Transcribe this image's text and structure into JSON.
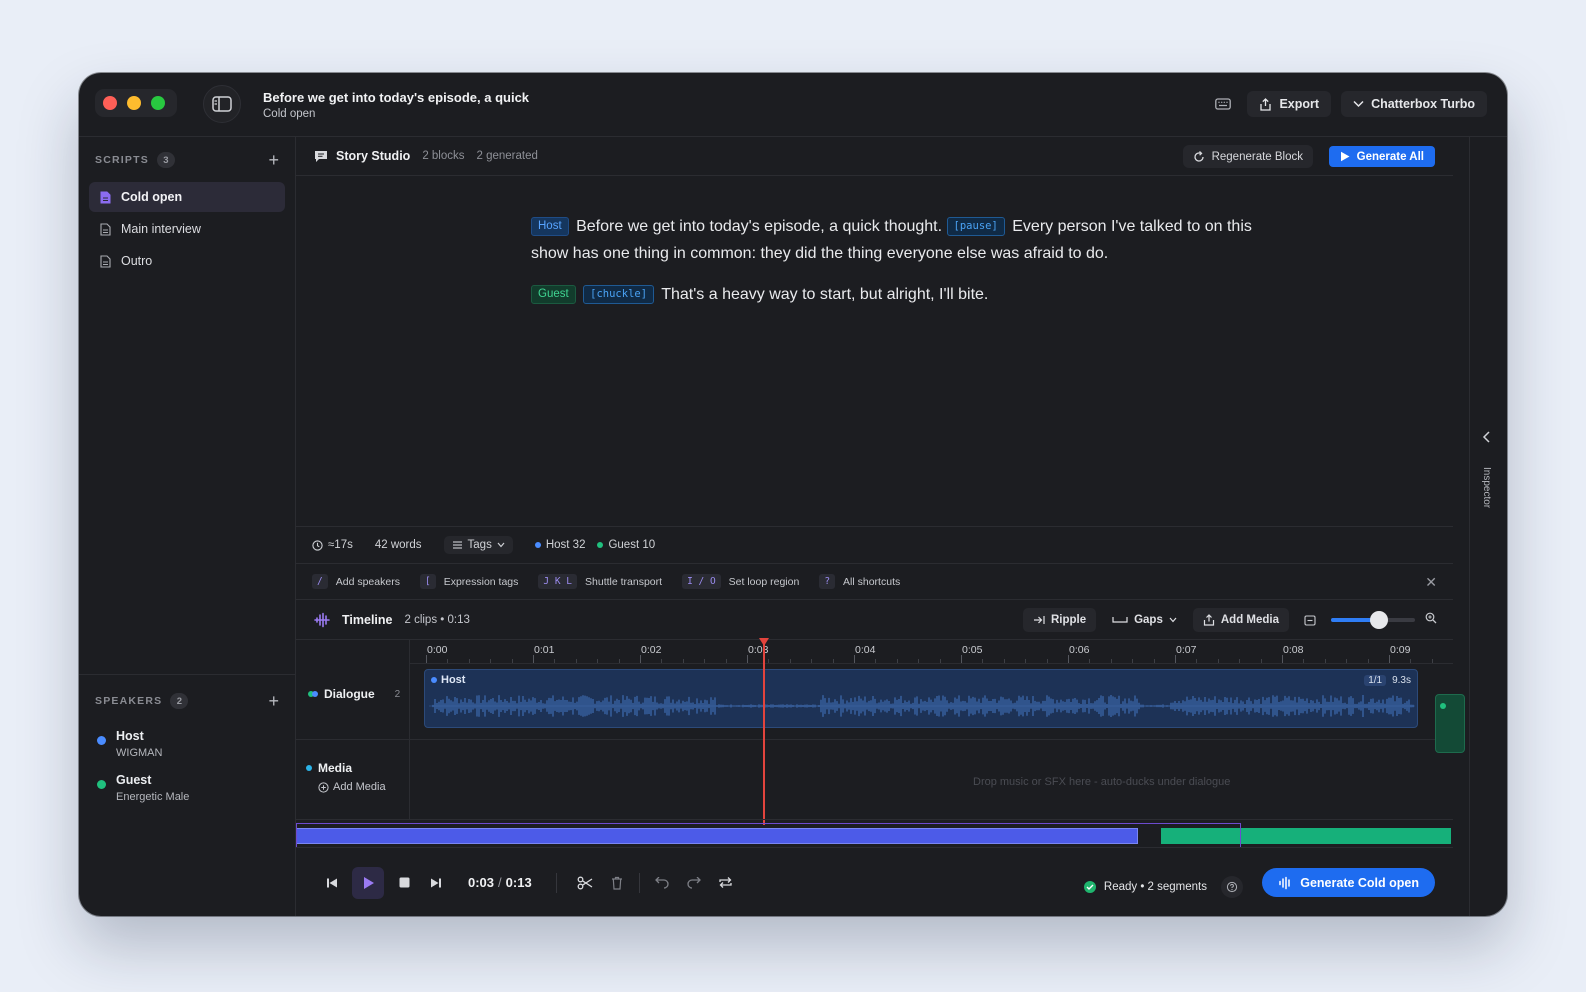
{
  "window": {
    "doc_title": "Before we get into today's episode, a quick",
    "doc_subtitle": "Cold open",
    "export_label": "Export",
    "model_label": "Chatterbox Turbo"
  },
  "sidebar": {
    "scripts_heading": "SCRIPTS",
    "scripts_count": "3",
    "scripts": [
      {
        "label": "Cold open",
        "active": true
      },
      {
        "label": "Main interview",
        "active": false
      },
      {
        "label": "Outro",
        "active": false
      }
    ],
    "speakers_heading": "SPEAKERS",
    "speakers_count": "2",
    "speakers": [
      {
        "name": "Host",
        "voice": "WIGMAN",
        "color": "#4a8cff"
      },
      {
        "name": "Guest",
        "voice": "Energetic Male",
        "color": "#20c07e"
      }
    ]
  },
  "studio": {
    "title": "Story Studio",
    "blocks": "2 blocks",
    "generated": "2 generated",
    "regen_label": "Regenerate Block",
    "generate_all_label": "Generate All"
  },
  "editor": {
    "p1": {
      "speaker_tag": "Host",
      "text_a": "Before we get into today's episode, a quick thought.",
      "expr_tag": "[pause]",
      "text_b": "Every person I've talked to on this show has one thing in common: they did the thing everyone else was afraid to do."
    },
    "p2": {
      "speaker_tag": "Guest",
      "expr_tag": "[chuckle]",
      "text_a": "That's a heavy way to start, but alright, I'll bite."
    }
  },
  "status": {
    "duration": "≈17s",
    "words": "42 words",
    "tags_label": "Tags",
    "host_count": "Host 32",
    "guest_count": "Guest 10"
  },
  "shortcuts": [
    {
      "key": "/",
      "label": "Add speakers"
    },
    {
      "key": "[",
      "label": "Expression tags"
    },
    {
      "key": "J K L",
      "label": "Shuttle transport"
    },
    {
      "key": "I / O",
      "label": "Set loop region"
    },
    {
      "key": "?",
      "label": "All shortcuts"
    }
  ],
  "timeline": {
    "title": "Timeline",
    "meta": "2 clips • 0:13",
    "ripple_label": "Ripple",
    "gaps_label": "Gaps",
    "add_media_label": "Add Media",
    "zoom_level": 0.57,
    "ticks": [
      "0:00",
      "0:01",
      "0:02",
      "0:03",
      "0:04",
      "0:05",
      "0:06",
      "0:07",
      "0:08",
      "0:09"
    ],
    "dialogue_label": "Dialogue",
    "dialogue_count": "2",
    "media_label": "Media",
    "media_add_label": "Add Media",
    "clip_name": "Host",
    "clip_take": "1/1",
    "clip_duration": "9.3s",
    "drop_hint": "Drop music or SFX here - auto-ducks under dialogue"
  },
  "transport": {
    "current": "0:03",
    "total": "0:13",
    "ready_text": "Ready • 2 segments",
    "generate_label": "Generate Cold open"
  },
  "inspector": {
    "label": "Inspector"
  }
}
